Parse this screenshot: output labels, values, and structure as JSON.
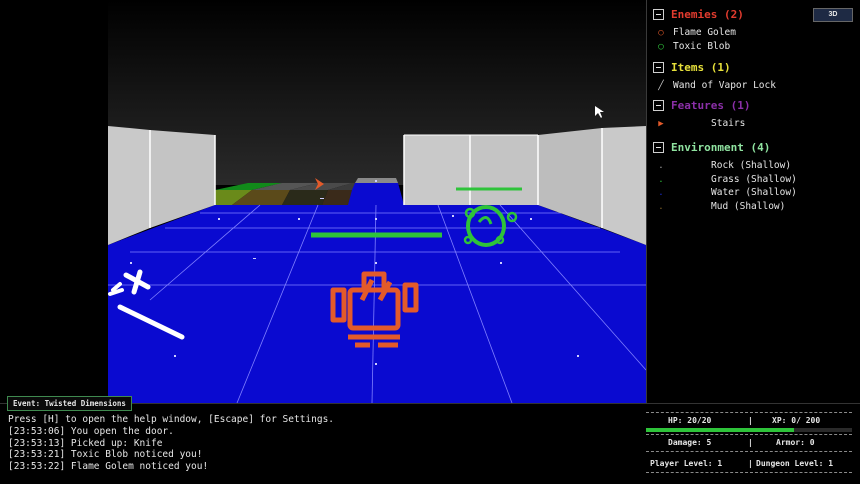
{
  "event": {
    "label": "Event: Twisted Dimensions"
  },
  "toggle_3d": {
    "label": "3D"
  },
  "sidebar": {
    "enemies": {
      "title": "Enemies (2)",
      "color": "#e33b2e",
      "items": [
        {
          "label": "Flame Golem",
          "icon": "flame-golem-icon",
          "color": "#e35a2a"
        },
        {
          "label": "Toxic Blob",
          "icon": "toxic-blob-icon",
          "color": "#2ec33a"
        }
      ]
    },
    "items": {
      "title": "Items (1)",
      "color": "#e6e03a",
      "items": [
        {
          "label": "Wand of Vapor Lock",
          "icon": "wand-icon"
        }
      ]
    },
    "features": {
      "title": "Features (1)",
      "color": "#8b2fa8",
      "items": [
        {
          "label": "Stairs",
          "icon": "stairs-icon",
          "color": "#e35a2a"
        }
      ]
    },
    "environment": {
      "title": "Environment (4)",
      "color": "#8fe3a0",
      "items": [
        {
          "label": "Rock (Shallow)",
          "color": "#aaaaaa"
        },
        {
          "label": "Grass (Shallow)",
          "color": "#2ec33a"
        },
        {
          "label": "Water (Shallow)",
          "color": "#1c2fd8"
        },
        {
          "label": "Mud (Shallow)",
          "color": "#8a6a2a"
        }
      ]
    }
  },
  "log": [
    "Press [H] to open the help window, [Escape] for Settings.",
    "[23:53:06] You open the door.",
    "[23:53:13] Picked up: Knife",
    "[23:53:21] Toxic Blob noticed you!",
    "[23:53:22] Flame Golem noticed you!"
  ],
  "stats": {
    "hp": "HP: 20/20",
    "hp_fraction": 1.0,
    "xp": "XP: 0/ 200",
    "damage": "Damage: 5",
    "armor": "Armor: 0",
    "player_level": "Player Level: 1",
    "dungeon_level": "Dungeon Level: 1",
    "divider": "|"
  },
  "colors": {
    "floor": "#0a0ad0",
    "wall": "#c9c9c9",
    "health": "#2ec33a",
    "golem": "#e35a2a"
  }
}
